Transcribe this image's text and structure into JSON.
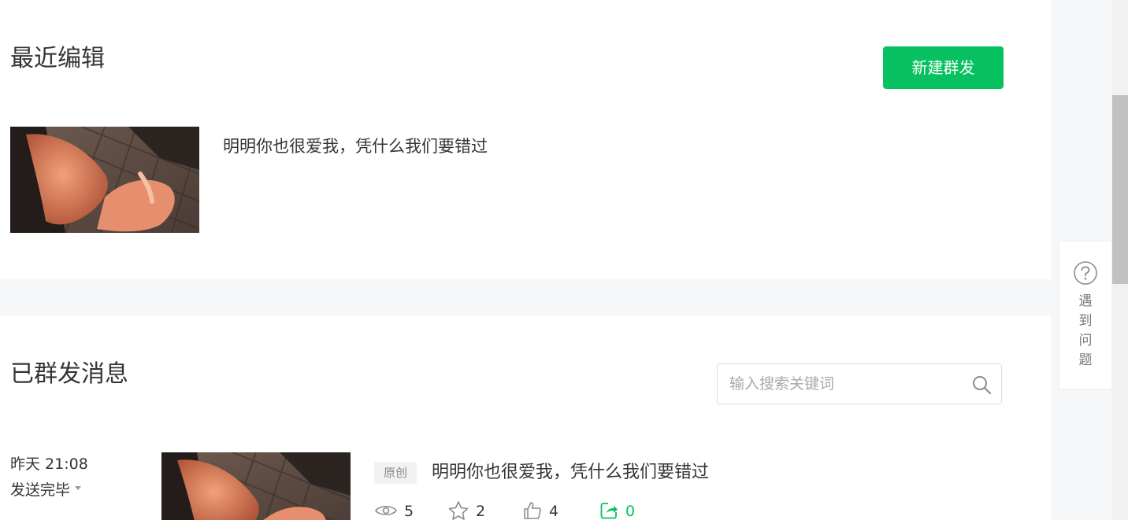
{
  "recent": {
    "title": "最近编辑",
    "new_button": "新建群发",
    "article_title": "明明你也很爱我，凭什么我们要错过"
  },
  "sent": {
    "title": "已群发消息",
    "search_placeholder": "输入搜索关键词",
    "messages": [
      {
        "time": "昨天 21:08",
        "status": "发送完毕",
        "badge": "原创",
        "title": "明明你也很爱我，凭什么我们要错过",
        "reads": "5",
        "favorites": "2",
        "likes": "4",
        "shares": "0"
      }
    ]
  },
  "help": {
    "chars": [
      "遇",
      "到",
      "问",
      "题"
    ]
  },
  "icons": {
    "search": "search-icon",
    "help": "question-circle-icon",
    "read": "eye-icon",
    "favorite": "star-icon",
    "like": "thumbs-up-icon",
    "share": "share-icon",
    "status_caret": "caret-down-icon"
  },
  "colors": {
    "accent": "#07c160",
    "page_bg": "#f6f7f9",
    "text": "#353535",
    "muted": "#8a8a8a"
  }
}
